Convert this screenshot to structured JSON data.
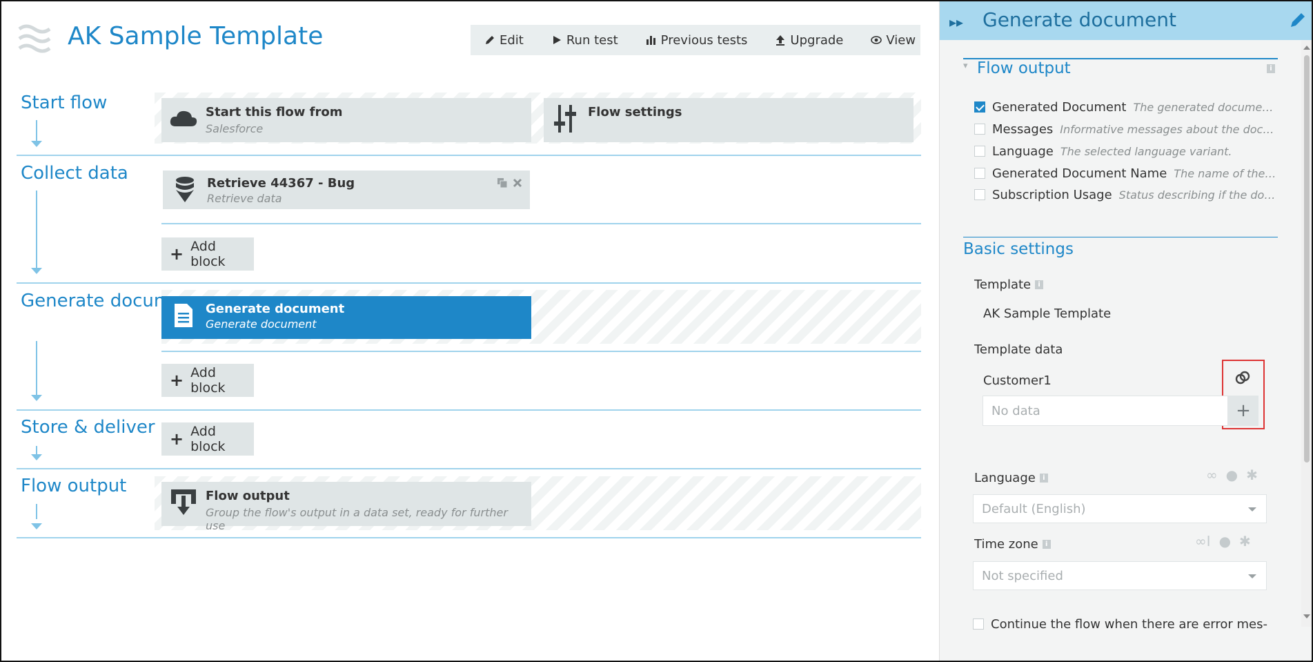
{
  "app": {
    "title": "AK Sample Template"
  },
  "toolbar": {
    "edit": "Edit",
    "run_test": "Run test",
    "previous_tests": "Previous tests",
    "upgrade": "Upgrade",
    "view": "View"
  },
  "flow": {
    "sections": {
      "start": "Start flow",
      "collect": "Collect data",
      "generate": "Generate documents",
      "store": "Store & deliver",
      "output": "Flow output"
    },
    "blocks": {
      "start_from_title": "Start this flow from",
      "start_from_sub": "Salesforce",
      "flow_settings_title": "Flow settings",
      "retrieve_title": "Retrieve 44367 - Bug",
      "retrieve_sub": "Retrieve data",
      "generate_title": "Generate document",
      "generate_sub": "Generate document",
      "output_title": "Flow output",
      "output_sub": "Group the flow's output in a data set, ready for further use"
    },
    "add_block": "Add block",
    "cut_off_label": "Flow output"
  },
  "panel": {
    "title": "Generate document",
    "flow_output": {
      "heading": "Flow output",
      "items": [
        {
          "name": "Generated Document",
          "desc": "The generated document i...",
          "checked": true
        },
        {
          "name": "Messages",
          "desc": "Informative messages about the docum...",
          "checked": false
        },
        {
          "name": "Language",
          "desc": "The selected language variant.",
          "checked": false
        },
        {
          "name": "Generated Document Name",
          "desc": "The name of the do...",
          "checked": false
        },
        {
          "name": "Subscription Usage",
          "desc": "Status describing if the docu...",
          "checked": false
        }
      ]
    },
    "basic_settings": {
      "heading": "Basic settings",
      "template_label": "Template",
      "template_value": "AK Sample Template",
      "template_data_label": "Template data",
      "customer_label": "Customer1",
      "customer_placeholder": "No data",
      "language_label": "Language",
      "language_value": "Default (English)",
      "timezone_label": "Time zone",
      "timezone_value": "Not specified",
      "continue_label": "Continue the flow when there are error mes-"
    }
  }
}
